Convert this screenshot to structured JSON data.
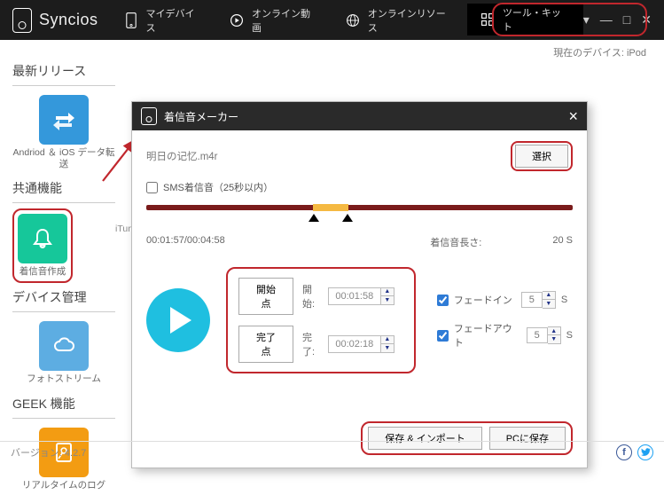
{
  "app": {
    "name": "Syncios"
  },
  "topnav": {
    "items": [
      {
        "label": "マイデバイス"
      },
      {
        "label": "オンライン動画"
      },
      {
        "label": "オンラインリソース"
      },
      {
        "label": "ツール・キット"
      }
    ]
  },
  "device_strip": {
    "text": "現在のデバイス: iPod"
  },
  "sidebar": {
    "sections": [
      {
        "title": "最新リリース",
        "items": [
          {
            "label": "Andriod ＆ iOS データ転送"
          }
        ]
      },
      {
        "title": "共通機能",
        "items": [
          {
            "label": "着信音作成"
          },
          {
            "label_partial": "iTun"
          }
        ]
      },
      {
        "title": "デバイス管理",
        "items": [
          {
            "label": "フォトストリーム"
          }
        ]
      },
      {
        "title": "GEEK 機能",
        "items": [
          {
            "label": "リアルタイムのログ"
          }
        ]
      }
    ]
  },
  "modal": {
    "title": "着信音メーカー",
    "file": "明日の记忆.m4r",
    "choose": "選択",
    "sms_limit": "SMS着信音（25秒以内）",
    "time": {
      "current": "00:01:57",
      "total": "00:04:58"
    },
    "len_label": "着信音長さ:",
    "len_value": "20 S",
    "mark": {
      "set_start": "開始点",
      "set_end": "完了点",
      "start_label": "開始:",
      "end_label": "完了:",
      "start_val": "00:01:58",
      "end_val": "00:02:18"
    },
    "fade": {
      "in_label": "フェードイン",
      "out_label": "フェードアウト",
      "in_val": "5",
      "out_val": "5",
      "suffix": "S"
    },
    "footer": {
      "save_import": "保存 & インポート",
      "save_pc": "PCに保存"
    }
  },
  "bottom": {
    "version_label": "バージョン: 4.2.7"
  }
}
